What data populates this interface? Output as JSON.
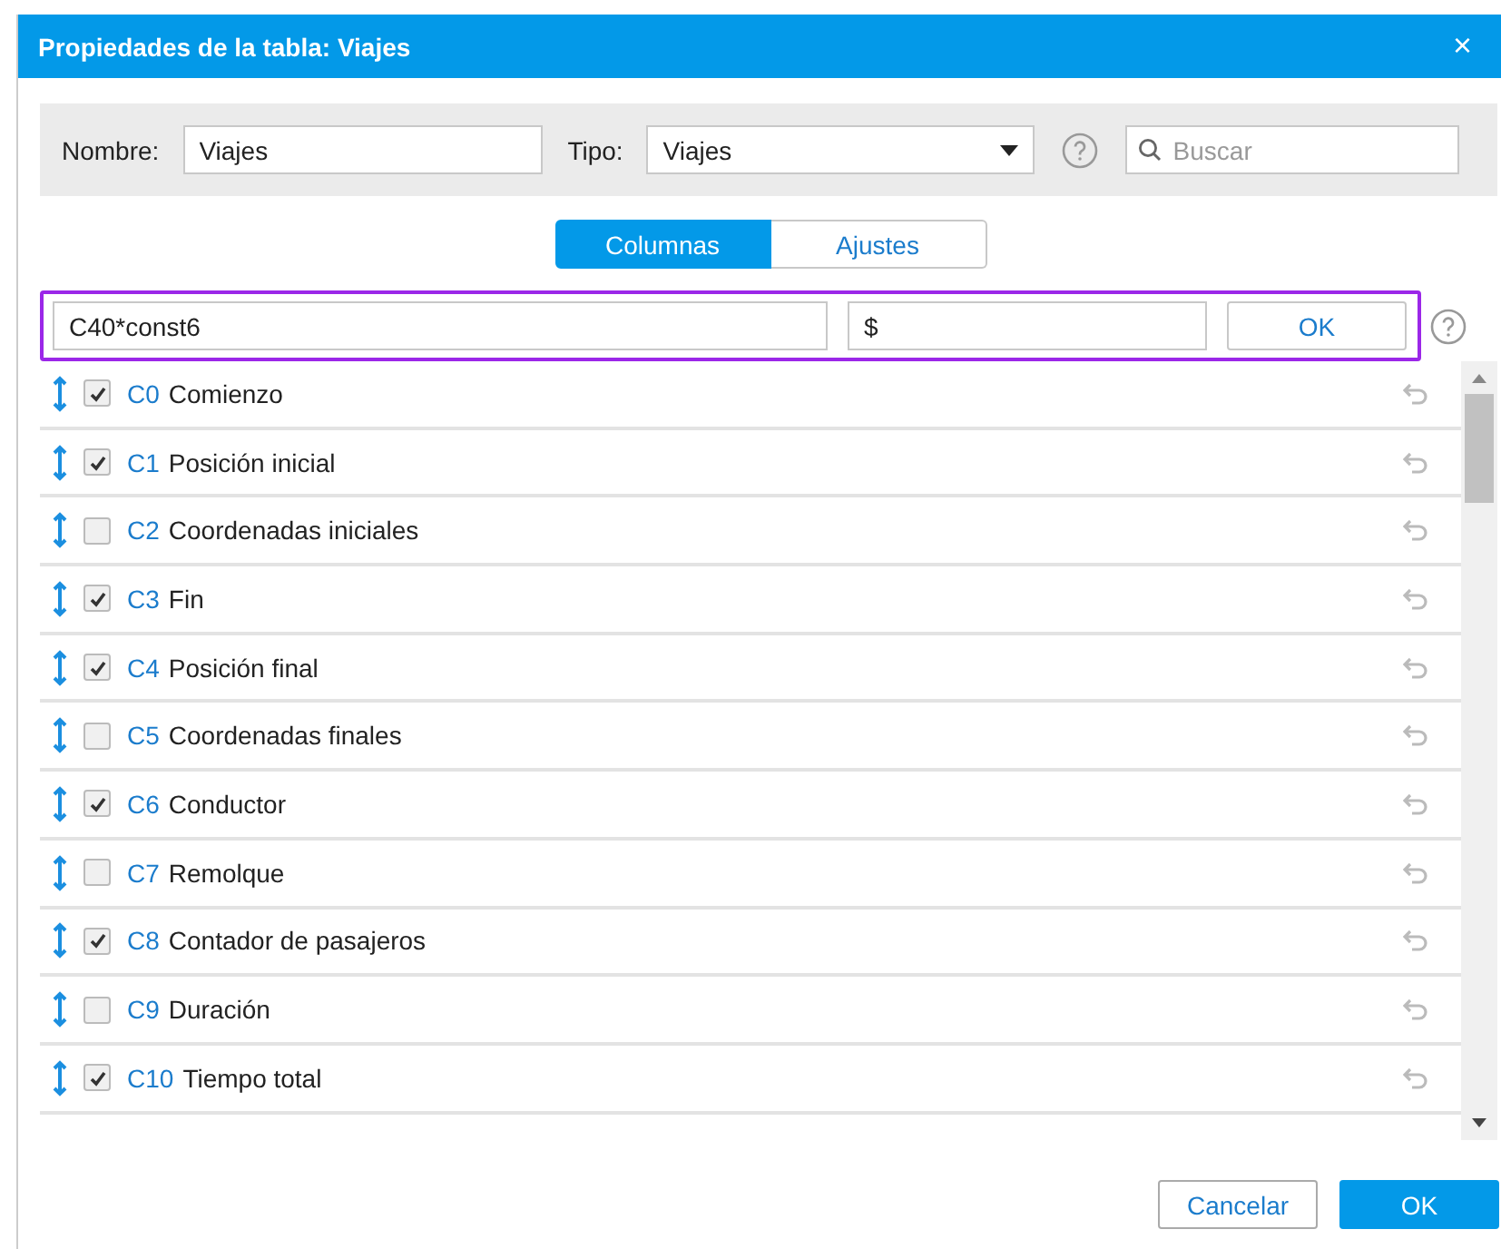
{
  "window": {
    "title": "Propiedades de la tabla: Viajes",
    "close": "×"
  },
  "top": {
    "name_label": "Nombre:",
    "name_value": "Viajes",
    "type_label": "Tipo:",
    "type_value": "Viajes",
    "search": {
      "placeholder": "Buscar"
    }
  },
  "tabs": [
    {
      "label": "Columnas",
      "selected": true
    },
    {
      "label": "Ajustes",
      "selected": false
    }
  ],
  "formula": {
    "expression": "C40*const6",
    "unit": "$",
    "button": "OK"
  },
  "columns": [
    {
      "code": "C0",
      "name": "Comienzo",
      "checked": true
    },
    {
      "code": "C1",
      "name": "Posición inicial",
      "checked": true
    },
    {
      "code": "C2",
      "name": "Coordenadas iniciales",
      "checked": false
    },
    {
      "code": "C3",
      "name": "Fin",
      "checked": true
    },
    {
      "code": "C4",
      "name": "Posición final",
      "checked": true
    },
    {
      "code": "C5",
      "name": "Coordenadas finales",
      "checked": false
    },
    {
      "code": "C6",
      "name": "Conductor",
      "checked": true
    },
    {
      "code": "C7",
      "name": "Remolque",
      "checked": false
    },
    {
      "code": "C8",
      "name": "Contador de pasajeros",
      "checked": true
    },
    {
      "code": "C9",
      "name": "Duración",
      "checked": false
    },
    {
      "code": "C10",
      "name": "Tiempo total",
      "checked": true
    }
  ],
  "buttons": [
    "Cancelar",
    "OK"
  ]
}
